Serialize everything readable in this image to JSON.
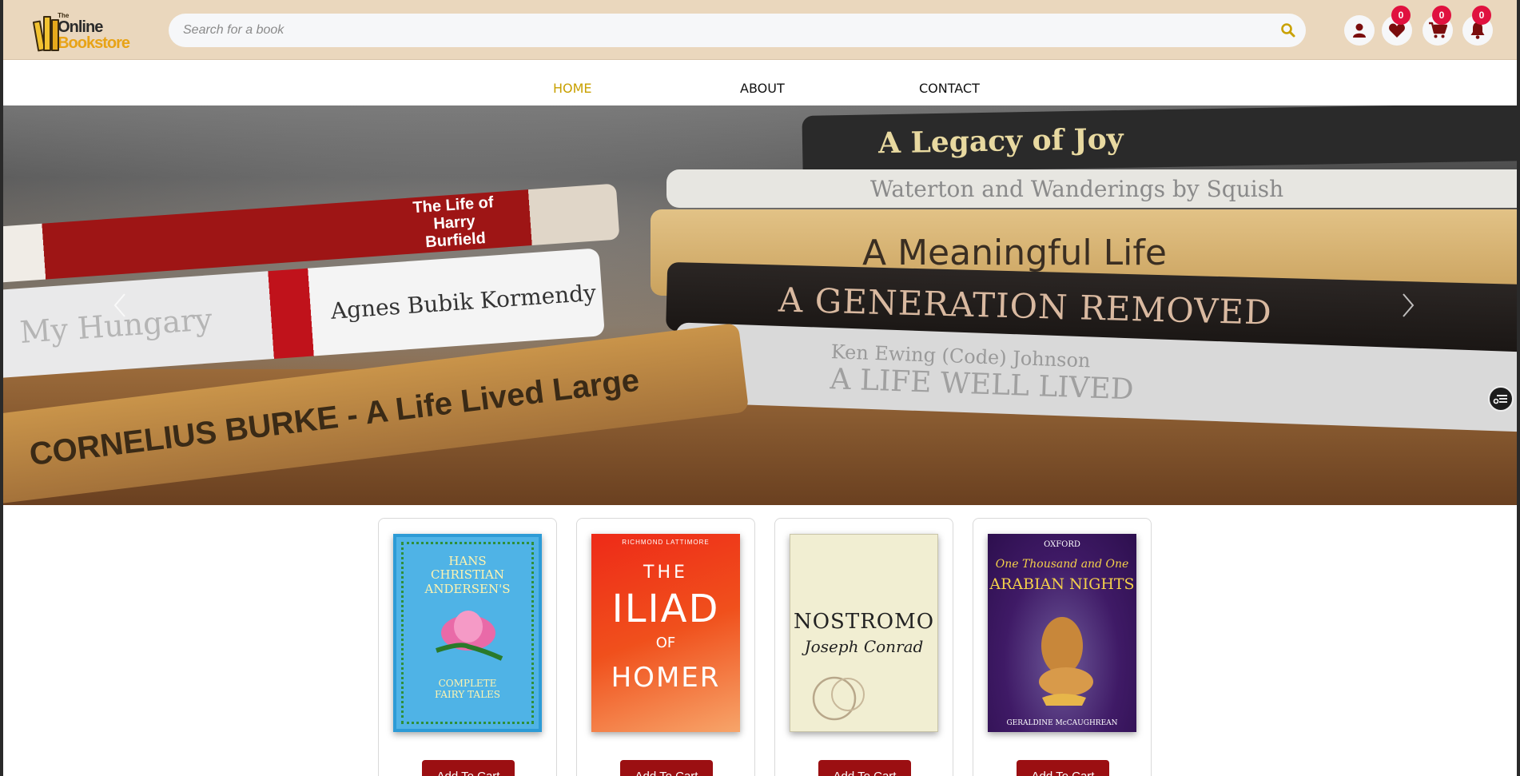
{
  "header": {
    "logo": {
      "the": "The",
      "online": "Online",
      "bookstore": "Bookstore"
    },
    "search": {
      "placeholder": "Search for a book",
      "value": ""
    },
    "icons": {
      "user": "user-icon",
      "wishlist": {
        "icon": "heart-icon",
        "count": "0"
      },
      "cart": {
        "icon": "cart-icon",
        "count": "0"
      },
      "notifications": {
        "icon": "bell-icon",
        "count": "0"
      }
    }
  },
  "nav": {
    "items": [
      {
        "label": "HOME",
        "active": true
      },
      {
        "label": "ABOUT",
        "active": false
      },
      {
        "label": "CONTACT",
        "active": false
      }
    ]
  },
  "hero": {
    "spines": [
      "A Legacy of Joy",
      "Waterton and Wanderings by Squish",
      "A Meaningful Life",
      "A GENERATION REMOVED",
      "Ken Ewing (Code) Johnson",
      "A LIFE WELL LIVED",
      "The Life of Harry Burfield",
      "Agnes Bubik Kormendy",
      "My Hungary",
      "CORNELIUS BURKE - A Life Lived Large"
    ]
  },
  "books": [
    {
      "cover_text": [
        "HANS",
        "CHRISTIAN",
        "ANDERSEN'S",
        "COMPLETE",
        "FAIRY TALES"
      ],
      "button": "Add To Cart",
      "cover_color": "#4fb3e6"
    },
    {
      "cover_text": [
        "RICHMOND LATTIMORE",
        "THE",
        "ILIAD",
        "OF",
        "HOMER"
      ],
      "button": "Add To Cart",
      "cover_color": "#e8341c"
    },
    {
      "cover_text": [
        "NOSTROMO",
        "Joseph Conrad"
      ],
      "button": "Add To Cart",
      "cover_color": "#f1eed2"
    },
    {
      "cover_text": [
        "OXFORD",
        "One Thousand and One",
        "ARABIAN NIGHTS",
        "GERALDINE McCAUGHREAN"
      ],
      "button": "Add To Cart",
      "cover_color": "#4a1d6e"
    }
  ],
  "colors": {
    "header_bg": "#ead7bd",
    "accent": "#c8a000",
    "badge": "#e0113f",
    "button": "#9b0f12"
  }
}
